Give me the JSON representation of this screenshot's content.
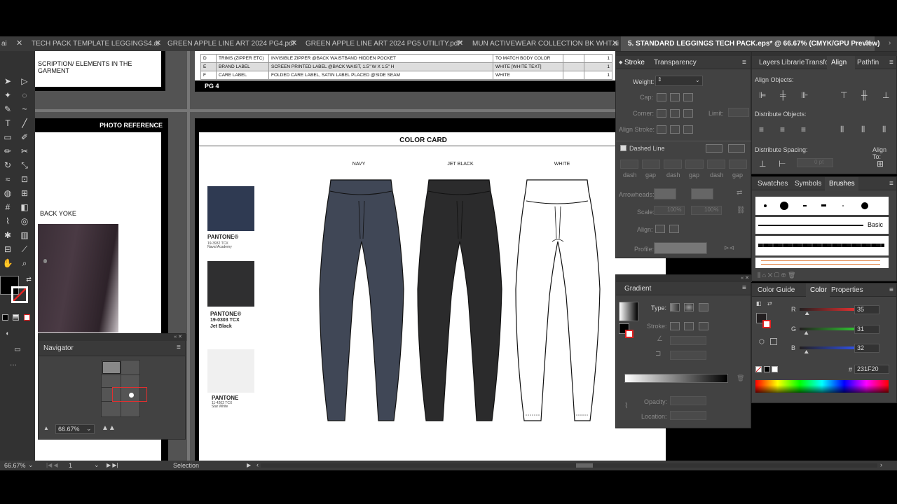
{
  "tabs": [
    {
      "label": "ai"
    },
    {
      "label": "TECH PACK TEMPLATE LEGGINGS4.ai"
    },
    {
      "label": "GREEN APPLE LINE ART 2024 PG4.pdf"
    },
    {
      "label": "GREEN APPLE LINE ART 2024 PG5 UTILITY.pdf*"
    },
    {
      "label": "MUN ACTIVEWEAR COLLECTION BK WHT.ai"
    },
    {
      "label": "5. STANDARD LEGGINGS TECH PACK.eps* @ 66.67% (CMYK/GPU Preview)"
    }
  ],
  "artboard_left": {
    "description_header": "SCRIPTION/ ELEMENTS IN THE GARMENT",
    "photo_reference": "PHOTO REFERENCE",
    "back_yoke": "BACK YOKE"
  },
  "trims_table": {
    "page_label": "PG 4",
    "rows": [
      {
        "code": "D",
        "item": "TRIMS (ZIPPER ETC)",
        "desc": "INVISIBLE ZIPPER @BACK WAISTBAND HIDDEN POCKET",
        "color": "TO MATCH BODY COLOR",
        "qty": "1"
      },
      {
        "code": "E",
        "item": "BRAND LABEL",
        "desc": "SCREEN PRINTED LABEL @BACK WAIST, 1.5\" W X 1.5\" H",
        "color": "WHITE [WHITE TEXT]",
        "qty": "1"
      },
      {
        "code": "F",
        "item": "CARE LABEL",
        "desc": "FOLDED CARE LABEL, SATIN LABEL PLACED @SIDE SEAM",
        "color": "WHITE",
        "qty": "1"
      }
    ]
  },
  "color_card": {
    "title": "COLOR CARD",
    "colorways": [
      {
        "name": "NAVY",
        "fill": "#404756"
      },
      {
        "name": "JET BLACK",
        "fill": "#2b2b2c"
      },
      {
        "name": "WHITE",
        "fill": "#ffffff"
      }
    ],
    "swatches": [
      {
        "brand": "PANTONE®",
        "code": "19-3932 TCX",
        "name": "Naval Academy",
        "color": "#2f3a52"
      },
      {
        "brand": "PANTONE®",
        "code": "19-0303 TCX",
        "name": "Jet Black",
        "color": "#2f2f30"
      },
      {
        "brand": "PANTONE",
        "code": "11-4202 TCX",
        "name": "Star White",
        "color": "#f0f0f0"
      }
    ]
  },
  "navigator": {
    "title": "Navigator",
    "zoom": "66.67%"
  },
  "stroke_panel": {
    "tabs": [
      "Stroke",
      "Transparency"
    ],
    "weight_label": "Weight:",
    "cap_label": "Cap:",
    "corner_label": "Corner:",
    "limit_label": "Limit:",
    "align_stroke_label": "Align Stroke:",
    "dashed_line_label": "Dashed Line",
    "dash_labels": [
      "dash",
      "gap",
      "dash",
      "gap",
      "dash",
      "gap"
    ],
    "arrowheads_label": "Arrowheads:",
    "scale_label": "Scale:",
    "scale_values": [
      "100%",
      "100%"
    ],
    "align_label": "Align:",
    "profile_label": "Profile:"
  },
  "align_panel": {
    "tabs": [
      "Layers",
      "Librarie",
      "Transfo",
      "Align",
      "Pathfin"
    ],
    "align_objects": "Align Objects:",
    "distribute_objects": "Distribute Objects:",
    "distribute_spacing": "Distribute Spacing:",
    "align_to": "Align To:",
    "spacing_value": "0 pt"
  },
  "brushes_panel": {
    "tabs": [
      "Swatches",
      "Symbols",
      "Brushes"
    ],
    "basic_label": "Basic"
  },
  "gradient_panel": {
    "title": "Gradient",
    "type_label": "Type:",
    "stroke_label": "Stroke:",
    "opacity_label": "Opacity:",
    "location_label": "Location:"
  },
  "color_panel": {
    "tabs": [
      "Color Guide",
      "Color",
      "Properties"
    ],
    "channels": [
      {
        "label": "R",
        "value": "35",
        "pct": 0.137,
        "color": "#e03030"
      },
      {
        "label": "G",
        "value": "31",
        "pct": 0.122,
        "color": "#30c030"
      },
      {
        "label": "B",
        "value": "32",
        "pct": 0.125,
        "color": "#3050e0"
      }
    ],
    "hex_label": "#",
    "hex_value": "231F20"
  },
  "status_bar": {
    "zoom": "66.67%",
    "page": "1",
    "tool": "Selection"
  }
}
